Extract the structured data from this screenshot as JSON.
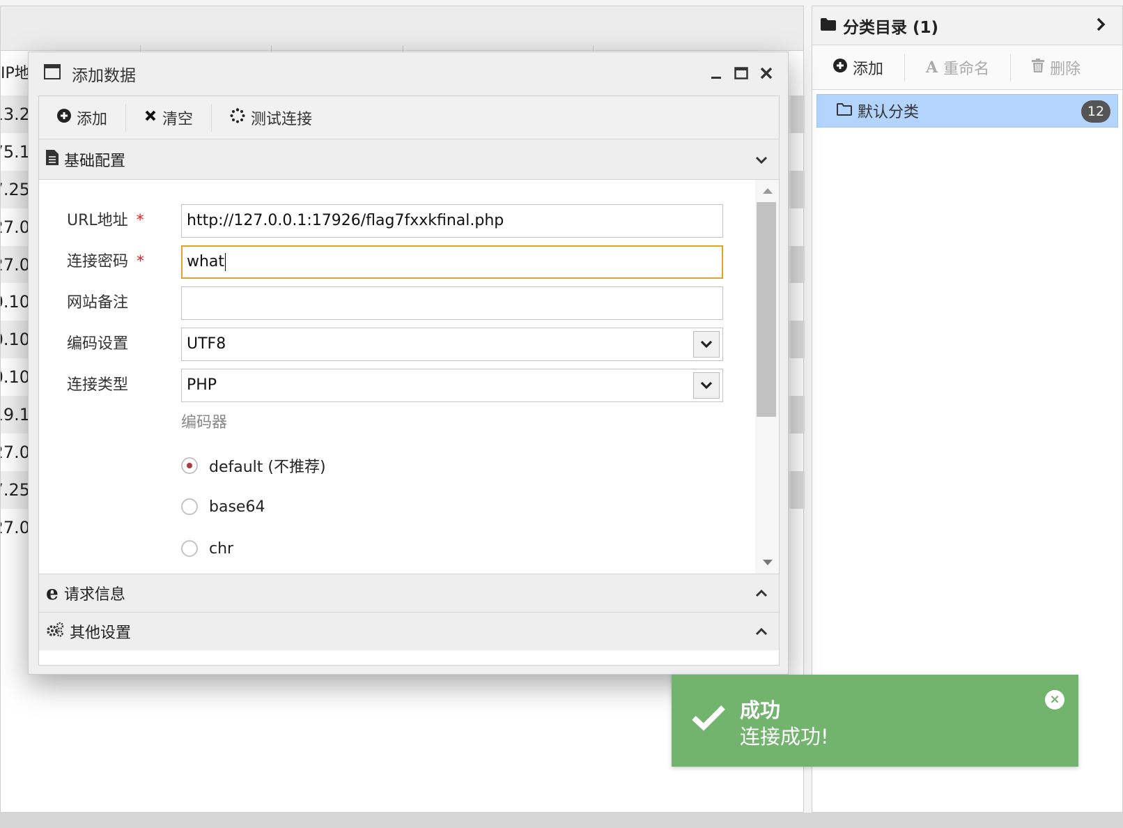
{
  "background": {
    "column_header": "IP地",
    "row_values": [
      "13.2",
      "75.1",
      "7.25",
      "27.0",
      "27.0",
      "0.10",
      "0.10",
      "0.10",
      "19.1",
      "27.0",
      "7.25",
      "27.0"
    ]
  },
  "right_panel": {
    "title": "分类目录 (1)",
    "toolbar": {
      "add": "添加",
      "rename": "重命名",
      "delete": "删除"
    },
    "categories": [
      {
        "name": "默认分类",
        "count": "12"
      }
    ]
  },
  "dialog": {
    "title": "添加数据",
    "toolbar": {
      "add": "添加",
      "clear": "清空",
      "test": "测试连接"
    },
    "sections": {
      "basic": "基础配置",
      "request": "请求信息",
      "other": "其他设置"
    },
    "form": {
      "url_label": "URL地址",
      "url_value": "http://127.0.0.1:17926/flag7fxxkfinal.php",
      "password_label": "连接密码",
      "password_value": "what",
      "note_label": "网站备注",
      "note_value": "",
      "encoding_label": "编码设置",
      "encoding_value": "UTF8",
      "type_label": "连接类型",
      "type_value": "PHP",
      "encoder_label": "编码器",
      "encoders": [
        "default (不推荐)",
        "base64",
        "chr"
      ],
      "required_mark": "*"
    }
  },
  "toast": {
    "title": "成功",
    "message": "连接成功!",
    "close": "×"
  },
  "colors": {
    "toast_bg": "#72b36e",
    "selected_category": "#b3d4fc",
    "focus_border": "#e0a32a",
    "required": "#e02020"
  }
}
